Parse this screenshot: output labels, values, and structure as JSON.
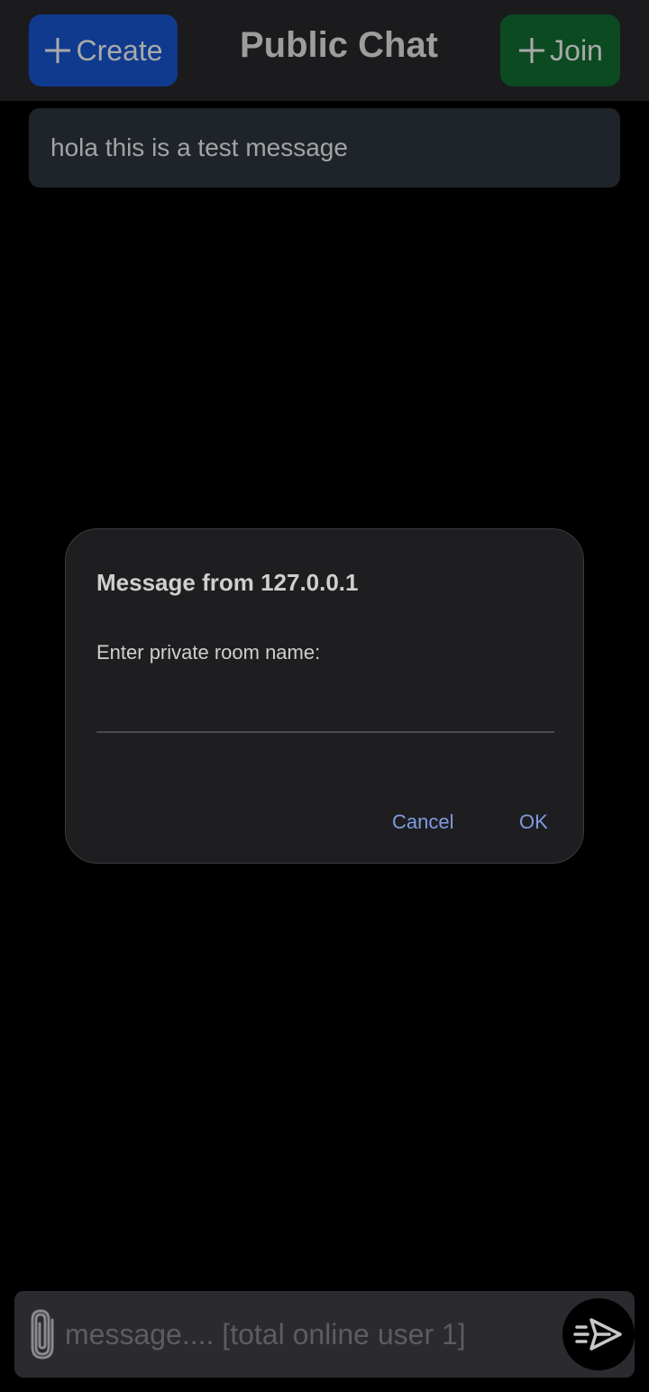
{
  "header": {
    "create_label": "Create",
    "title": "Public Chat",
    "join_label": "Join"
  },
  "messages": [
    {
      "text": "hola this is a test message"
    }
  ],
  "dialog": {
    "title": "Message from 127.0.0.1",
    "prompt": "Enter private room name:",
    "input_value": "",
    "cancel_label": "Cancel",
    "ok_label": "OK"
  },
  "composer": {
    "placeholder": "message.... [total online user 1]"
  },
  "icons": {
    "plus": "plus-icon",
    "attach": "paperclip-icon",
    "send": "send-icon"
  },
  "colors": {
    "create_button": "#0f3a8e",
    "join_button": "#0c4a22",
    "dialog_action": "#7f9be0"
  }
}
